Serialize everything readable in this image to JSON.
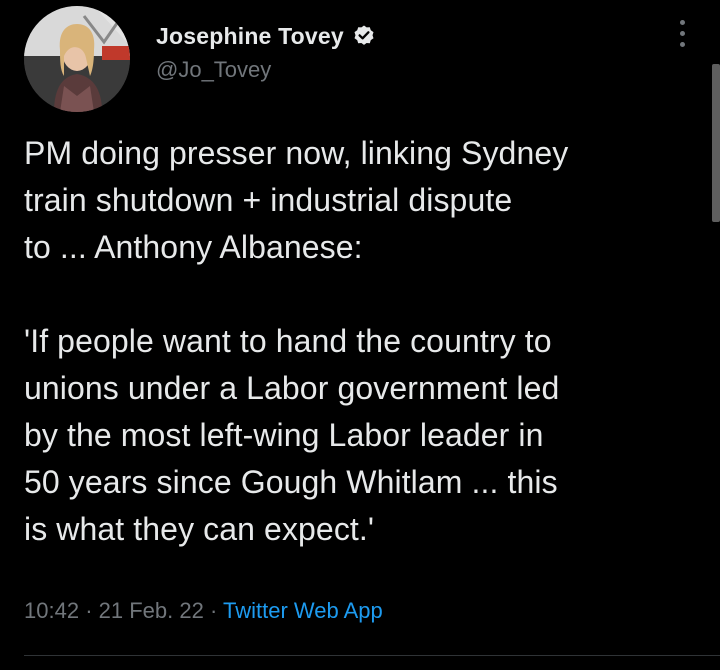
{
  "tweet": {
    "author": {
      "display_name": "Josephine Tovey",
      "handle": "@Jo_Tovey",
      "verified": true,
      "avatar_icon": "profile-photo"
    },
    "text": "PM doing presser now, linking Sydney\ntrain shutdown + industrial dispute\nto ... Anthony Albanese:\n\n'If people want to hand the country to\nunions under a Labor government led\nby the most left-wing Labor leader in\n50 years since Gough Whitlam ... this\nis what they can expect.'",
    "time": "10:42",
    "separator": "·",
    "date": "21 Feb. 22",
    "source": "Twitter Web App"
  },
  "colors": {
    "background": "#000000",
    "text": "#e7e9ea",
    "muted": "#71767b",
    "link": "#1d9bf0",
    "verified_badge": "#e7e9ea"
  },
  "icons": {
    "verified": "verified-badge-icon",
    "more": "more-options-icon"
  }
}
